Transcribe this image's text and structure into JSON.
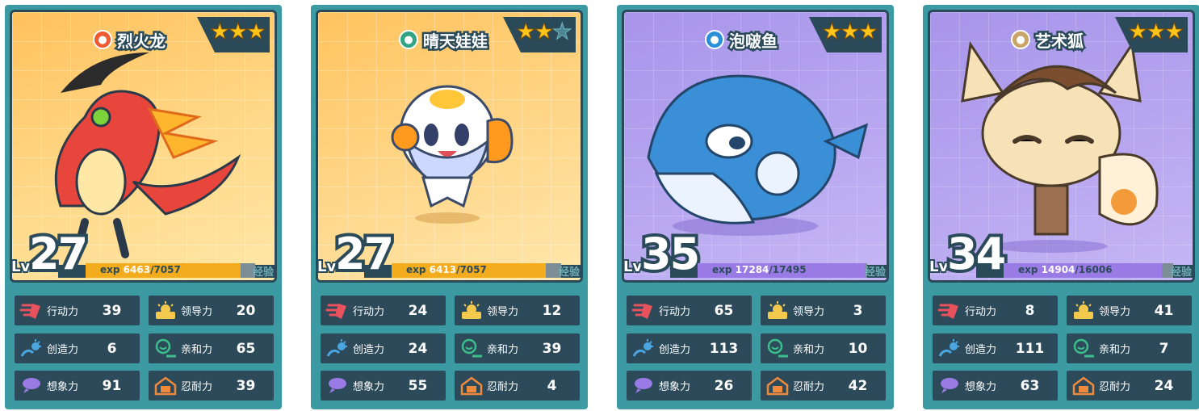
{
  "cards": [
    {
      "name": "烈火龙",
      "type_icon": "fire-type-icon",
      "type_color": "#ee5b33",
      "stars": 3,
      "max_stars": 3,
      "level": "27",
      "lv_label": "Lv",
      "exp_label": "exp",
      "exp_current": "6463",
      "exp_total": "/7057",
      "exp_fraction": 0.916,
      "exp_color": "#f3ac1d",
      "exp_tag": "经验",
      "theme": "fire",
      "stats": {
        "action": {
          "label": "行动力",
          "value": "39"
        },
        "leadership": {
          "label": "领导力",
          "value": "20"
        },
        "creativity": {
          "label": "创造力",
          "value": "6"
        },
        "affinity": {
          "label": "亲和力",
          "value": "65"
        },
        "imagination": {
          "label": "想象力",
          "value": "91"
        },
        "endurance": {
          "label": "忍耐力",
          "value": "39"
        }
      }
    },
    {
      "name": "晴天娃娃",
      "type_icon": "grass-type-icon",
      "type_color": "#2fa585",
      "stars": 2,
      "max_stars": 3,
      "level": "27",
      "lv_label": "Lv",
      "exp_label": "exp",
      "exp_current": "6413",
      "exp_total": "/7057",
      "exp_fraction": 0.909,
      "exp_color": "#f3ac1d",
      "exp_tag": "经验",
      "theme": "grass",
      "stats": {
        "action": {
          "label": "行动力",
          "value": "24"
        },
        "leadership": {
          "label": "领导力",
          "value": "12"
        },
        "creativity": {
          "label": "创造力",
          "value": "24"
        },
        "affinity": {
          "label": "亲和力",
          "value": "39"
        },
        "imagination": {
          "label": "想象力",
          "value": "55"
        },
        "endurance": {
          "label": "忍耐力",
          "value": "4"
        }
      }
    },
    {
      "name": "泡啵鱼",
      "type_icon": "water-type-icon",
      "type_color": "#2b8fd8",
      "stars": 3,
      "max_stars": 3,
      "level": "35",
      "lv_label": "Lv",
      "exp_label": "exp",
      "exp_current": "17284",
      "exp_total": "/17495",
      "exp_fraction": 0.988,
      "exp_color": "#9a7be6",
      "exp_tag": "经验",
      "theme": "water",
      "stats": {
        "action": {
          "label": "行动力",
          "value": "65"
        },
        "leadership": {
          "label": "领导力",
          "value": "3"
        },
        "creativity": {
          "label": "创造力",
          "value": "113"
        },
        "affinity": {
          "label": "亲和力",
          "value": "10"
        },
        "imagination": {
          "label": "想象力",
          "value": "26"
        },
        "endurance": {
          "label": "忍耐力",
          "value": "42"
        }
      }
    },
    {
      "name": "艺术狐",
      "type_icon": "art-type-icon",
      "type_color": "#c8a468",
      "stars": 3,
      "max_stars": 3,
      "level": "34",
      "lv_label": "Lv",
      "exp_label": "exp",
      "exp_current": "14904",
      "exp_total": "/16006",
      "exp_fraction": 0.931,
      "exp_color": "#9a7be6",
      "exp_tag": "经验",
      "theme": "art",
      "stats": {
        "action": {
          "label": "行动力",
          "value": "8"
        },
        "leadership": {
          "label": "领导力",
          "value": "41"
        },
        "creativity": {
          "label": "创造力",
          "value": "111"
        },
        "affinity": {
          "label": "亲和力",
          "value": "7"
        },
        "imagination": {
          "label": "想象力",
          "value": "63"
        },
        "endurance": {
          "label": "忍耐力",
          "value": "24"
        }
      }
    }
  ]
}
